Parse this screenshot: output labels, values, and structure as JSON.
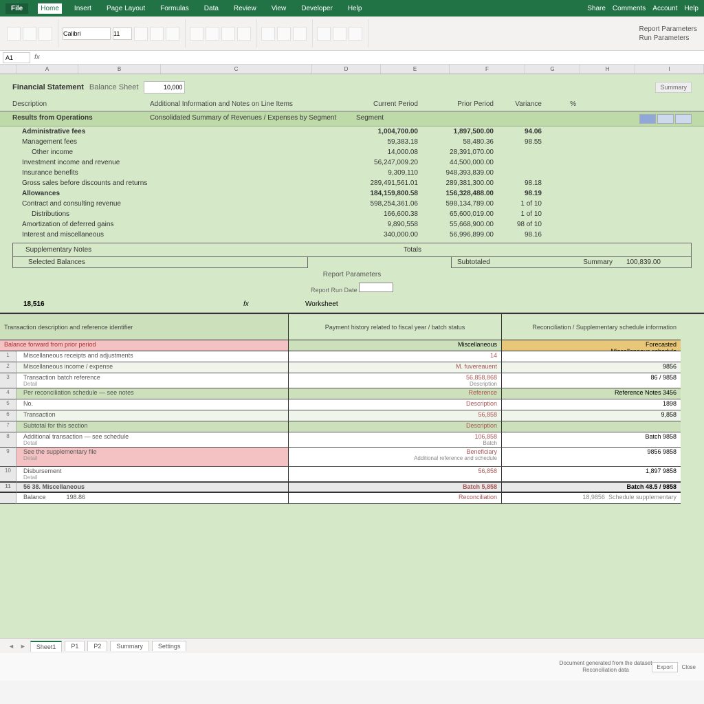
{
  "ribbon": {
    "file": "File",
    "tabs": [
      "Home",
      "Insert",
      "Page Layout",
      "Formulas",
      "Data",
      "Review",
      "View",
      "Developer",
      "Help"
    ],
    "right": [
      "Share",
      "Comments",
      "Account",
      "Help"
    ]
  },
  "toolbar": {
    "font": "Calibri",
    "size": "11",
    "side_title": "Report Parameters",
    "side_sub": "Run Parameters"
  },
  "formula": {
    "cell": "A1",
    "fx": "fx"
  },
  "fin": {
    "title_a": "Financial Statement",
    "title_b": "Balance Sheet",
    "inp": "10,000",
    "link": "Summary",
    "cols": [
      "Description",
      "Additional Information and Notes on Line Items",
      "Current Period",
      "Prior Period",
      "Variance",
      "%"
    ],
    "group_a": "Results from Operations",
    "group_b": "Consolidated Summary of Revenues / Expenses by Segment",
    "group_c": "Segment",
    "rows": [
      {
        "label": "Administrative fees",
        "c1": "1,004,700.00",
        "c2": "1,897,500.00",
        "c3": "94.06",
        "indent": 1,
        "bold": true
      },
      {
        "label": "Management fees",
        "c1": "59,383.18",
        "c2": "58,480.36",
        "c3": "98.55",
        "indent": 1
      },
      {
        "label": "Other income",
        "c1": "14,000.08",
        "c2": "28,391,070.00",
        "c3": "",
        "indent": 2
      },
      {
        "label": "Investment income and revenue",
        "c1": "56,247,009.20",
        "c2": "44,500,000.00",
        "c3": "",
        "indent": 1
      },
      {
        "label": "Insurance benefits",
        "c1": "9,309,110",
        "c2": "948,393,839.00",
        "c3": "",
        "indent": 1
      },
      {
        "label": "Gross sales before discounts and returns",
        "c1": "289,491,561.01",
        "c2": "289,381,300.00",
        "c3": "98.18",
        "indent": 1
      },
      {
        "label": "Allowances",
        "c1": "184,159,800.58",
        "c2": "156,328,488.00",
        "c3": "98.19",
        "indent": 1,
        "bold": true
      },
      {
        "label": "Contract and consulting revenue",
        "c1": "598,254,361.06",
        "c2": "598,134,789.00",
        "c3": "1 of 10",
        "indent": 1
      },
      {
        "label": "Distributions",
        "c1": "166,600.38",
        "c2": "65,600,019.00",
        "c3": "1 of 10",
        "indent": 2
      },
      {
        "label": "Amortization of deferred gains",
        "c1": "9,890,558",
        "c2": "55,668,900.00",
        "c3": "98 of 10",
        "indent": 1
      },
      {
        "label": "Interest and miscellaneous",
        "c1": "340,000.00",
        "c2": "56,996,899.00",
        "c3": "98.16",
        "indent": 1
      }
    ],
    "boxed_a": "Supplementary Notes",
    "boxed_b": "Totals",
    "box_left": "Selected Balances",
    "box_r_a": "Subtotaled",
    "box_r_b": "Summary",
    "box_r_val": "100,839.00",
    "note": "Report Parameters",
    "note2": "Report Run Date"
  },
  "lower": {
    "hdr_a": "18,516",
    "hdr_b": "fx",
    "hdr_c": "Worksheet",
    "head1": "Transaction description and reference identifier",
    "head2": "Payment history related to fiscal year / batch status",
    "head3": "Reconciliation / Supplementary schedule information",
    "sub1": "Balance forward from prior period",
    "sub2": "Miscellaneous",
    "sub3_a": "Forecasted",
    "sub3_b": "Miscellaneous schedule",
    "rows": [
      {
        "a": "Miscellaneous receipts and adjustments",
        "a2": "",
        "b": "14",
        "b2": "",
        "c": "",
        "cls": ""
      },
      {
        "a": "Miscellaneous income / expense",
        "a2": "",
        "b": "M. fuvereauent",
        "b2": "",
        "c": "9856",
        "cls": "alt"
      },
      {
        "a": "Transaction batch reference",
        "a2": "Detail",
        "b": "56,858,868",
        "b2": "Description",
        "c": "86 / 9858",
        "cls": ""
      },
      {
        "a": "Per reconciliation schedule — see notes",
        "a2": "",
        "b": "Reference",
        "b2": "",
        "c": "Reference Notes 3456",
        "cls": "green"
      },
      {
        "a": "No.",
        "a2": "",
        "b": "Description",
        "b2": "",
        "c": "1898",
        "cls": ""
      },
      {
        "a": "Transaction",
        "a2": "",
        "b": "56,858",
        "b2": "",
        "c": "9,858",
        "cls": "alt"
      },
      {
        "a": "Subtotal for this section",
        "a2": "",
        "b": "Description",
        "b2": "",
        "c": "",
        "cls": "green"
      },
      {
        "a": "Additional transaction — see schedule",
        "a2": "Detail",
        "b": "106,858",
        "b2": "Batch",
        "c": "Batch 9858",
        "cls": ""
      },
      {
        "a": "See the supplementary file",
        "a2": "Detail",
        "b": "Beneficiary",
        "b2": "Additional reference and schedule",
        "c": "9856 9858",
        "cls": "pink dbl"
      },
      {
        "a": "Disbursement",
        "a2": "Detail",
        "b": "56,858",
        "b2": "",
        "c": "1,897 9858",
        "cls": ""
      },
      {
        "a": "56 38. Miscellaneous",
        "a2": "",
        "b": "Batch 5,858",
        "b2": "",
        "c": "Batch 48.5 / 9858",
        "cls": "thick"
      }
    ],
    "ftr_cells": [
      "Balance",
      "198.86",
      "",
      "Reconciliation",
      "",
      "18,9856",
      "",
      "Schedule supplementary"
    ]
  },
  "tabs": {
    "items": [
      "Sheet1",
      "P1",
      "P2",
      "Summary",
      "Settings"
    ],
    "active": 0
  },
  "footer": {
    "note1": "Document generated from the dataset",
    "note2": "Reconciliation data",
    "btn": "Export",
    "close": "Close"
  }
}
